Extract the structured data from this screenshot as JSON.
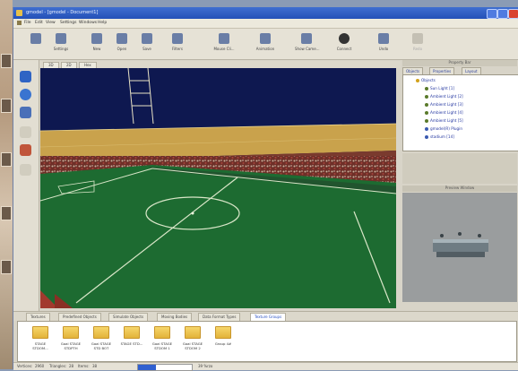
{
  "window": {
    "title": "gmodel - [gmodel - Document1]"
  },
  "menu": [
    "File",
    "Edit",
    "View",
    "Settings",
    "Windows",
    "Help"
  ],
  "toolbar": [
    {
      "label": "",
      "icon": "new-icon"
    },
    {
      "label": "Settings",
      "icon": "settings-icon"
    },
    {
      "label": "New",
      "icon": "new-doc-icon"
    },
    {
      "label": "Open",
      "icon": "open-icon"
    },
    {
      "label": "Save",
      "icon": "save-icon"
    },
    {
      "label": "Filters",
      "icon": "filter-icon"
    },
    {
      "label": "Mouse Cli...",
      "icon": "mouse-icon"
    },
    {
      "label": "Animation",
      "icon": "animation-icon"
    },
    {
      "label": "Show Came...",
      "icon": "camera-icon"
    },
    {
      "label": "Connect",
      "icon": "connect-icon"
    },
    {
      "label": "Undo",
      "icon": "undo-icon"
    },
    {
      "label": "Redo",
      "icon": "redo-icon"
    }
  ],
  "view_tabs": [
    "3D",
    "2D",
    "Hex"
  ],
  "right_panel": {
    "title": "Property Bar",
    "tabs": [
      "Objects",
      "Properties",
      "Layout"
    ],
    "tree": [
      "Objects",
      "Sun Light [1]",
      "Ambient Light [2]",
      "Ambient Light [3]",
      "Ambient Light [4]",
      "Ambient Light [5]",
      "gmodel(R) Plugin",
      "stadium [14]"
    ],
    "preview_title": "Preview Window"
  },
  "bottom_tabs": [
    "Textures",
    "Predefined Objects",
    "Simulate Objects",
    "Moving Bodies",
    "Data Format Types",
    "Texture Groups"
  ],
  "active_bottom_tab": 5,
  "assets": [
    {
      "name": "STAGE STDOM..."
    },
    {
      "name": "Goal STAGE STDPTH"
    },
    {
      "name": "Goal STAGE STD BOT"
    },
    {
      "name": "STAGE STD..."
    },
    {
      "name": "Goal STAGE STDOM 1"
    },
    {
      "name": "Goal STAGE STDOM 2"
    },
    {
      "name": "Group 4#"
    }
  ],
  "status": {
    "vertices_label": "Vertices:",
    "vertices": "2960",
    "triangles_label": "Triangles:",
    "triangles": "28",
    "items_label": "Items:",
    "items": "38",
    "progress": 0.33,
    "zoom": "39 %rzo"
  },
  "colors": {
    "titlebar": "#2a55bf",
    "field": "#1f6a2e",
    "sky": "#0f1a56",
    "active_tab": "#2850c0"
  }
}
